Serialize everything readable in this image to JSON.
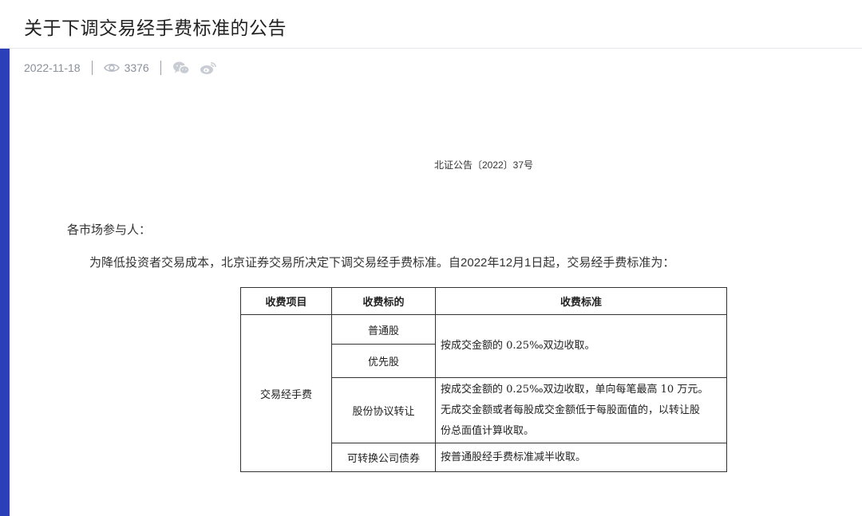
{
  "header": {
    "title": "关于下调交易经手费标准的公告"
  },
  "meta": {
    "date": "2022-11-18",
    "views": "3376",
    "share_icons": [
      "wechat-icon",
      "weibo-icon"
    ]
  },
  "article": {
    "doc_number": "北证公告〔2022〕37号",
    "salutation": "各市场参与人：",
    "paragraph": "为降低投资者交易成本，北京证券交易所决定下调交易经手费标准。自2022年12月1日起，交易经手费标准为："
  },
  "table": {
    "headers": [
      "收费项目",
      "收费标的",
      "收费标准"
    ],
    "item": "交易经手费",
    "rows": [
      {
        "target": "普通股"
      },
      {
        "target": "优先股"
      },
      {
        "target": "股份协议转让",
        "standard_lines": [
          "按成交金额的 0.25‰双边收取，单向每笔最高 10 万元。",
          "无成交金额或者每股成交金额低于每股面值的，以转让股",
          "份总面值计算收取。"
        ]
      },
      {
        "target": "可转换公司债券",
        "standard": "按普通股经手费标准减半收取。"
      }
    ],
    "shared_standard": "按成交金额的 0.25‰双边收取。"
  },
  "colors": {
    "banner": "#3a55d6",
    "meta_text": "#8a8f99",
    "icon": "#c8ccd3"
  }
}
